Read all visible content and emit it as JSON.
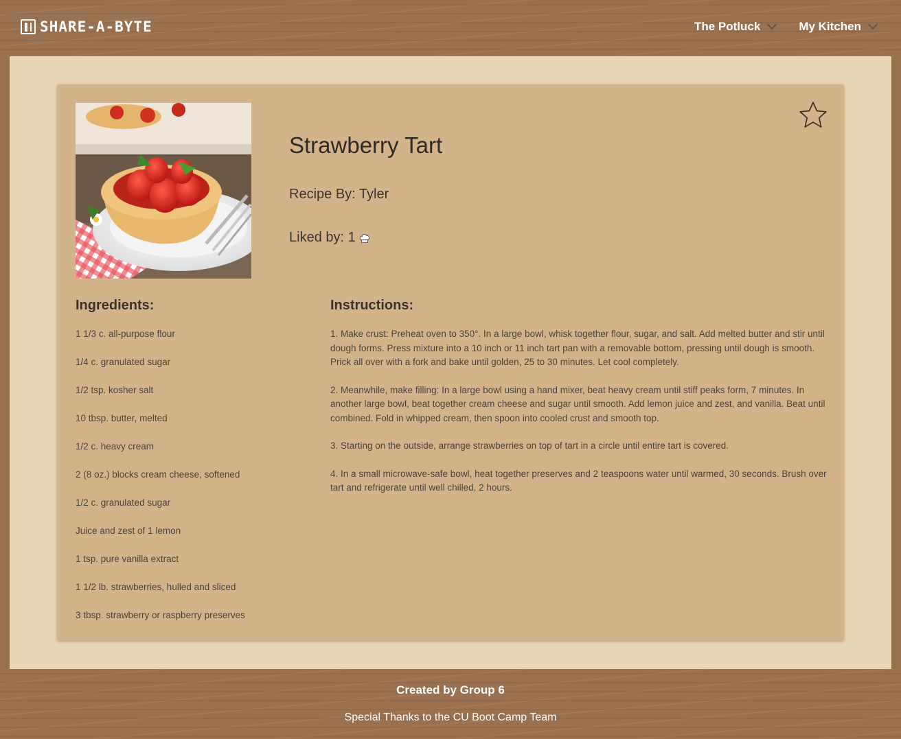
{
  "header": {
    "brand": "SHARE-A-BYTE",
    "nav": [
      {
        "label": "The Potluck"
      },
      {
        "label": "My Kitchen"
      }
    ]
  },
  "recipe": {
    "title": "Strawberry Tart",
    "author": "Recipe By: Tyler",
    "liked_label": "Liked by: 1",
    "photo_icon": "strawberry-tart-photo",
    "favorite_icon": "star-icon",
    "likes_icon": "chef-hat-icon",
    "ingredients_heading": "Ingredients:",
    "ingredients": [
      "1 1/3 c. all-purpose flour",
      "1/4 c. granulated sugar",
      "1/2 tsp. kosher salt",
      "10 tbsp. butter, melted",
      "1/2 c. heavy cream",
      "2 (8 oz.) blocks cream cheese, softened",
      "1/2 c. granulated sugar",
      "Juice and zest of 1 lemon",
      "1 tsp. pure vanilla extract",
      "1 1/2 lb. strawberries, hulled and sliced",
      "3 tbsp. strawberry or raspberry preserves"
    ],
    "instructions_heading": "Instructions:",
    "instructions": [
      "1. Make crust: Preheat oven to 350°. In a large bowl, whisk together flour, sugar, and salt. Add melted butter and stir until dough forms. Press mixture into a 10 inch or 11 inch tart pan with a removable bottom, pressing until dough is smooth. Prick all over with a fork and bake until golden, 25 to 30 minutes. Let cool completely.",
      "2. Meanwhile, make filling: In a large bowl using a hand mixer, beat heavy cream until stiff peaks form, 7 minutes. In another large bowl, beat together cream cheese and sugar until smooth. Add lemon juice and zest, and vanilla. Beat until combined. Fold in whipped cream, then spoon into cooled crust and smooth top.",
      "3. Starting on the outside, arrange strawberries on top of tart in a circle until entire tart is covered.",
      "4. In a small microwave-safe bowl, heat together preserves and 2 teaspoons water until warmed, 30 seconds. Brush over tart and refrigerate until well chilled, 2 hours."
    ]
  },
  "footer": {
    "credit": "Created by Group 6",
    "thanks": "Special Thanks to the CU Boot Camp Team"
  },
  "colors": {
    "wood": "#9a7150",
    "page_bg": "#ead6b4",
    "card_bg": "#d3b48a",
    "text": "#3a332d"
  }
}
